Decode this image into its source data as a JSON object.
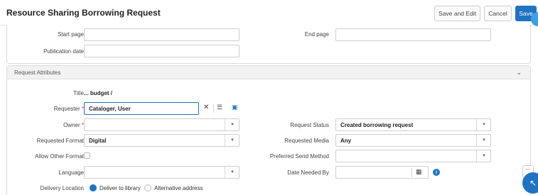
{
  "header": {
    "title": "Resource Sharing Borrowing Request",
    "save_and_edit_label": "Save and Edit",
    "cancel_label": "Cancel",
    "save_label": "Save"
  },
  "top_section": {
    "start_page_label": "Start page",
    "start_page_value": "",
    "end_page_label": "End page",
    "end_page_value": "",
    "publication_date_label": "Publication date",
    "publication_date_value": ""
  },
  "request_attributes": {
    "section_title": "Request Attributes",
    "title_label": "Title",
    "title_value": "... budget /",
    "requester_label": "Requester",
    "requester_value": "Cataloger, User",
    "owner_label": "Owner",
    "owner_value": "",
    "request_status_label": "Request Status",
    "request_status_value": "Created borrowing request",
    "requested_format_label": "Requested Format",
    "requested_format_value": "Digital",
    "requested_media_label": "Requested Media",
    "requested_media_value": "Any",
    "allow_other_format_label": "Allow Other Format",
    "allow_other_format_checked": false,
    "preferred_send_method_label": "Preferred Send Method",
    "preferred_send_method_value": "",
    "language_label": "Language",
    "language_value": "",
    "date_needed_by_label": "Date Needed By",
    "date_needed_by_value": "",
    "delivery_location_label": "Delivery Location",
    "delivery_options": [
      "Deliver to library",
      "Alternative address"
    ],
    "delivery_selected": "Deliver to library",
    "required_marker": "*"
  },
  "colors": {
    "accent": "#1f73c2",
    "required": "#d0342c",
    "section_header_bg": "#f2f2f2"
  },
  "icons": {
    "clear": "close-icon",
    "list": "list-icon",
    "card": "id-card-icon",
    "calendar": "calendar-icon",
    "info": "info-icon",
    "dropdown": "chevron-down-icon"
  }
}
